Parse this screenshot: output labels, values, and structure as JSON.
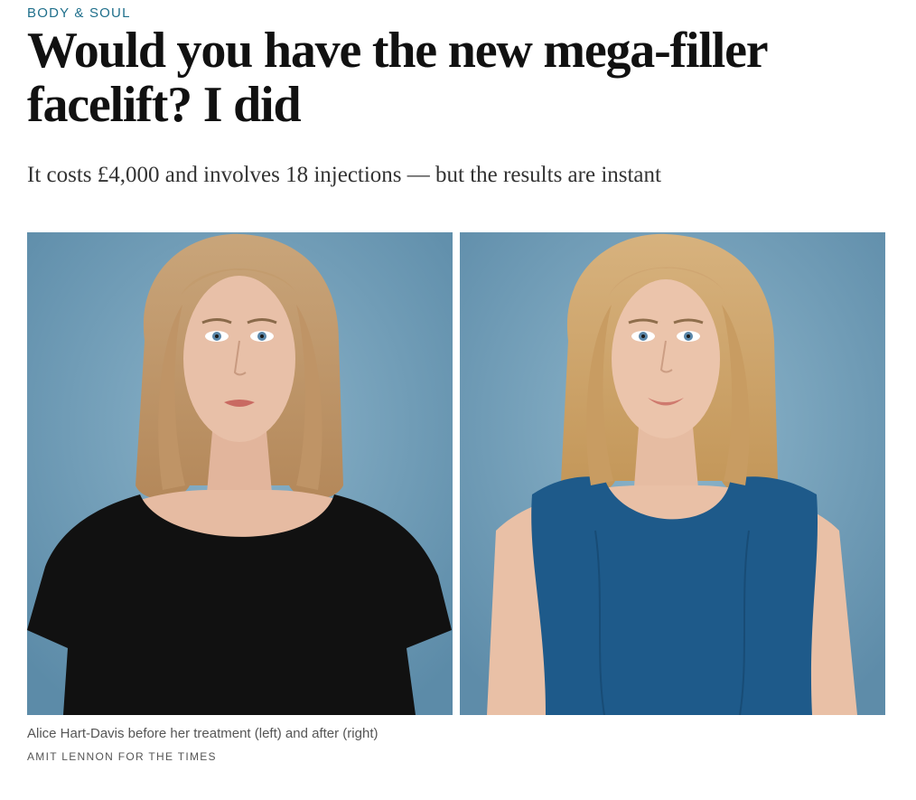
{
  "section": {
    "label": "BODY & SOUL"
  },
  "headline": "Would you have the new mega-filler facelift? I did",
  "standfirst": "It costs £4,000 and involves 18 injections — but the results are instant",
  "figure": {
    "images": [
      {
        "name": "before-photo",
        "subject": "woman-black-tshirt",
        "top_color": "#111111",
        "background_color": "#6f9cb7"
      },
      {
        "name": "after-photo",
        "subject": "woman-blue-dress",
        "top_color": "#1e5a8a",
        "background_color": "#6f9cb7"
      }
    ],
    "caption": "Alice Hart-Davis before her treatment (left) and after (right)",
    "credit": "AMIT LENNON FOR THE TIMES"
  },
  "colors": {
    "section_label": "#1f6f8b",
    "headline": "#111111",
    "standfirst": "#333333",
    "caption": "#555555"
  }
}
